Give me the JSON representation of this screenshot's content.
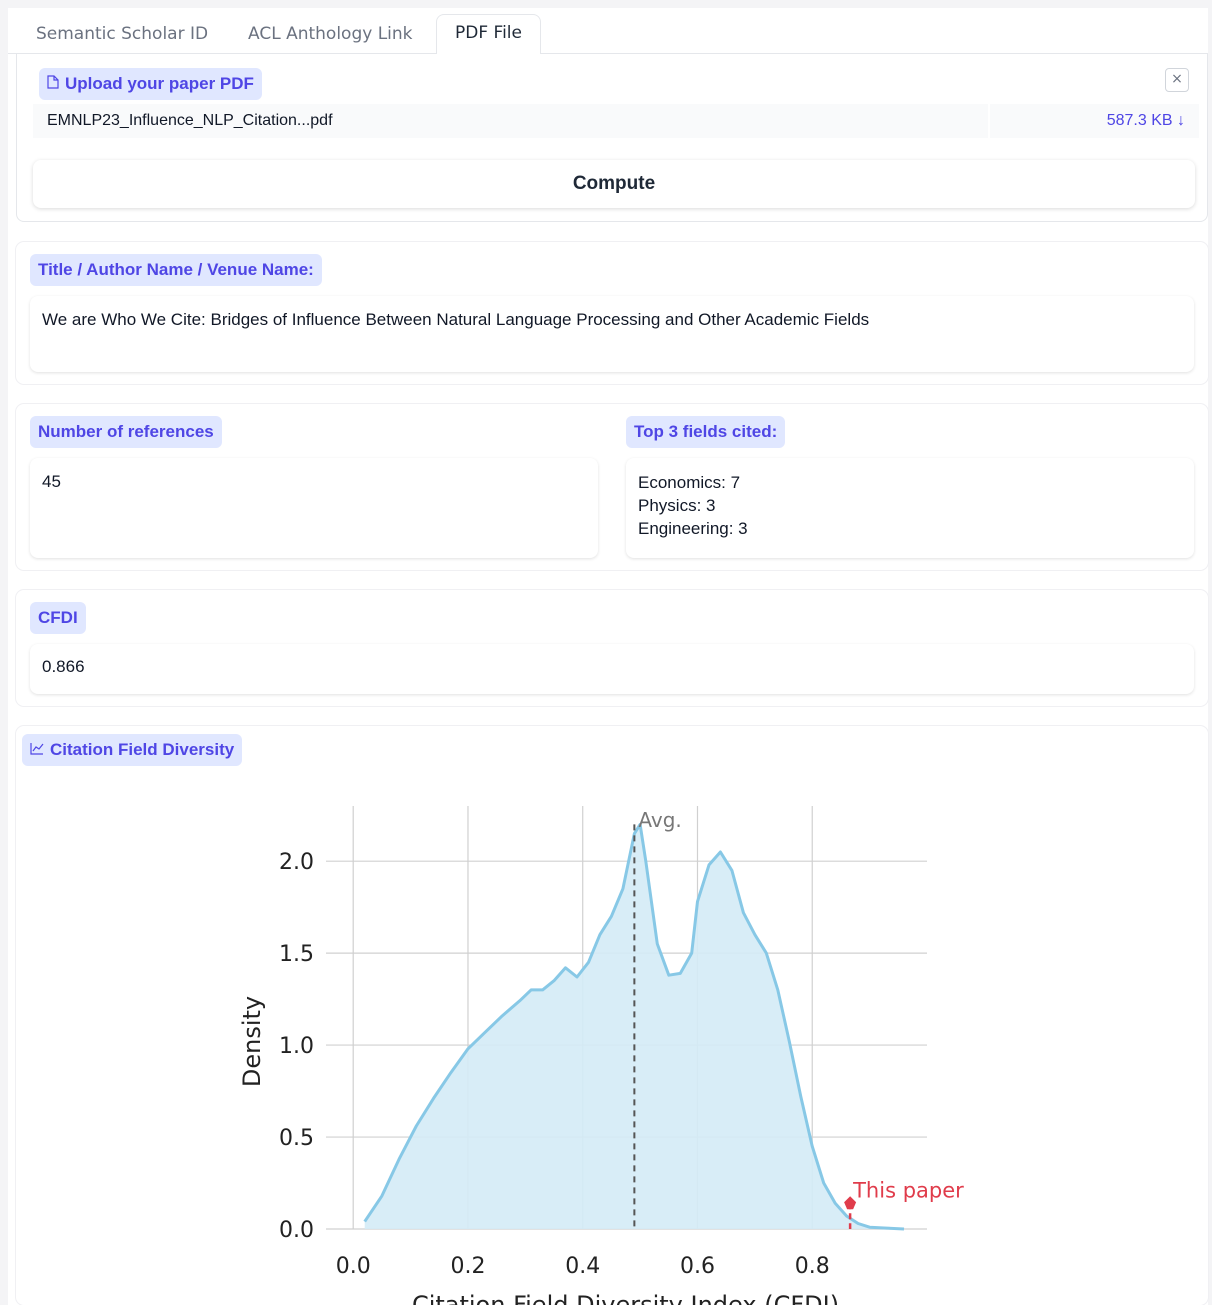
{
  "tabs": [
    "Semantic Scholar ID",
    "ACL Anthology Link",
    "PDF File"
  ],
  "active_tab": "PDF File",
  "upload": {
    "label": "Upload your paper PDF",
    "file_name": "EMNLP23_Influence_NLP_Citation...pdf",
    "file_size": "587.3 KB ↓",
    "close": "×"
  },
  "compute_label": "Compute",
  "title_section": {
    "label": "Title / Author Name / Venue Name:",
    "value": "We are Who We Cite: Bridges of Influence Between Natural Language Processing and Other Academic Fields"
  },
  "references": {
    "label": "Number of references",
    "value": "45"
  },
  "top_fields": {
    "label": "Top 3 fields cited:",
    "lines": [
      "Economics: 7",
      "Physics: 3",
      "Engineering: 3"
    ]
  },
  "cfdi": {
    "label": "CFDI",
    "value": "0.866"
  },
  "plot_label": "Citation Field Diversity",
  "colors": {
    "accent": "#4f46e5",
    "chip_bg": "#e0e7ff",
    "kde_fill": "#d4ebf6",
    "kde_line": "#87c8e6",
    "marker": "#e03c4b"
  },
  "chart_data": {
    "type": "area",
    "xlabel": "Citation Field Diversity Index (CFDI)",
    "ylabel": "Density",
    "xlim": [
      -0.03,
      1.0
    ],
    "ylim": [
      0,
      2.3
    ],
    "xticks": [
      "0.0",
      "0.2",
      "0.4",
      "0.6",
      "0.8"
    ],
    "yticks": [
      "0.0",
      "0.5",
      "1.0",
      "1.5",
      "2.0"
    ],
    "grid": true,
    "series": [
      {
        "x": [
          0.02,
          0.05,
          0.08,
          0.11,
          0.14,
          0.17,
          0.2,
          0.23,
          0.26,
          0.29,
          0.31,
          0.33,
          0.35,
          0.37,
          0.39,
          0.41,
          0.43,
          0.45,
          0.47,
          0.49,
          0.5,
          0.51,
          0.53,
          0.55,
          0.57,
          0.59,
          0.6,
          0.62,
          0.64,
          0.66,
          0.68,
          0.7,
          0.72,
          0.74,
          0.76,
          0.78,
          0.8,
          0.82,
          0.84,
          0.86,
          0.88,
          0.9,
          0.93,
          0.96
        ],
        "y": [
          0.04,
          0.18,
          0.38,
          0.56,
          0.71,
          0.85,
          0.98,
          1.07,
          1.16,
          1.24,
          1.3,
          1.3,
          1.35,
          1.42,
          1.37,
          1.45,
          1.6,
          1.7,
          1.85,
          2.15,
          2.2,
          2.0,
          1.55,
          1.38,
          1.39,
          1.5,
          1.78,
          1.98,
          2.05,
          1.95,
          1.72,
          1.6,
          1.5,
          1.3,
          1.02,
          0.72,
          0.45,
          0.25,
          0.14,
          0.07,
          0.03,
          0.01,
          0.005,
          0.0
        ]
      }
    ],
    "annotations": [
      {
        "text": "Avg.",
        "x": 0.49
      },
      {
        "text": "This paper",
        "x": 0.866,
        "y": 0.14
      }
    ]
  }
}
